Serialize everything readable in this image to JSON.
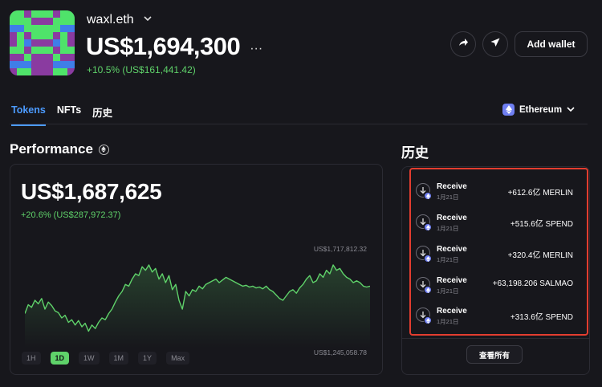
{
  "header": {
    "wallet_name": "waxl.eth",
    "balance": "US$1,694,300",
    "more": "···",
    "change": "+10.5% (US$161,441.42)",
    "add_wallet_label": "Add wallet",
    "icons": [
      "share-icon",
      "send-icon"
    ]
  },
  "tabs": [
    {
      "label": "Tokens",
      "active": true
    },
    {
      "label": "NFTs",
      "active": false
    },
    {
      "label": "历史",
      "active": false
    }
  ],
  "network": {
    "label": "Ethereum"
  },
  "performance": {
    "title": "Performance",
    "value": "US$1,687,625",
    "change": "+20.6% (US$287,972.37)",
    "max_label": "US$1,717,812.32",
    "min_label": "US$1,245,058.78",
    "ranges": [
      {
        "label": "1H",
        "active": false
      },
      {
        "label": "1D",
        "active": true
      },
      {
        "label": "1W",
        "active": false
      },
      {
        "label": "1M",
        "active": false
      },
      {
        "label": "1Y",
        "active": false
      },
      {
        "label": "Max",
        "active": false
      }
    ],
    "line_color": "#5fd26a",
    "series": [
      0.35,
      0.45,
      0.42,
      0.5,
      0.46,
      0.52,
      0.4,
      0.48,
      0.44,
      0.38,
      0.36,
      0.3,
      0.33,
      0.25,
      0.28,
      0.22,
      0.27,
      0.2,
      0.24,
      0.15,
      0.22,
      0.18,
      0.25,
      0.3,
      0.28,
      0.35,
      0.4,
      0.48,
      0.55,
      0.6,
      0.68,
      0.66,
      0.74,
      0.8,
      0.78,
      0.88,
      0.84,
      0.9,
      0.82,
      0.86,
      0.74,
      0.8,
      0.7,
      0.78,
      0.62,
      0.68,
      0.5,
      0.4,
      0.6,
      0.55,
      0.62,
      0.6,
      0.66,
      0.63,
      0.68,
      0.7,
      0.72,
      0.74,
      0.7,
      0.73,
      0.76,
      0.74,
      0.72,
      0.7,
      0.68,
      0.66,
      0.67,
      0.65,
      0.66,
      0.64,
      0.65,
      0.63,
      0.66,
      0.62,
      0.6,
      0.56,
      0.52,
      0.5,
      0.55,
      0.6,
      0.62,
      0.58,
      0.64,
      0.68,
      0.74,
      0.78,
      0.7,
      0.72,
      0.8,
      0.76,
      0.84,
      0.8,
      0.9,
      0.84,
      0.86,
      0.8,
      0.76,
      0.74,
      0.7,
      0.72,
      0.7,
      0.66,
      0.65,
      0.66
    ]
  },
  "history": {
    "title": "历史",
    "view_all": "查看所有",
    "items": [
      {
        "type": "Receive",
        "date": "1月21日",
        "amount": "+612.6亿 MERLIN"
      },
      {
        "type": "Receive",
        "date": "1月21日",
        "amount": "+515.6亿 SPEND"
      },
      {
        "type": "Receive",
        "date": "1月21日",
        "amount": "+320.4亿 MERLIN"
      },
      {
        "type": "Receive",
        "date": "1月21日",
        "amount": "+63,198.206 SALMAO"
      },
      {
        "type": "Receive",
        "date": "1月21日",
        "amount": "+313.6亿 SPEND"
      }
    ]
  },
  "colors": {
    "background": "#17171c",
    "accent_blue": "#4c9bff",
    "positive": "#5fd26a",
    "highlight": "#e33d2f",
    "eth": "#6f7ff2"
  }
}
